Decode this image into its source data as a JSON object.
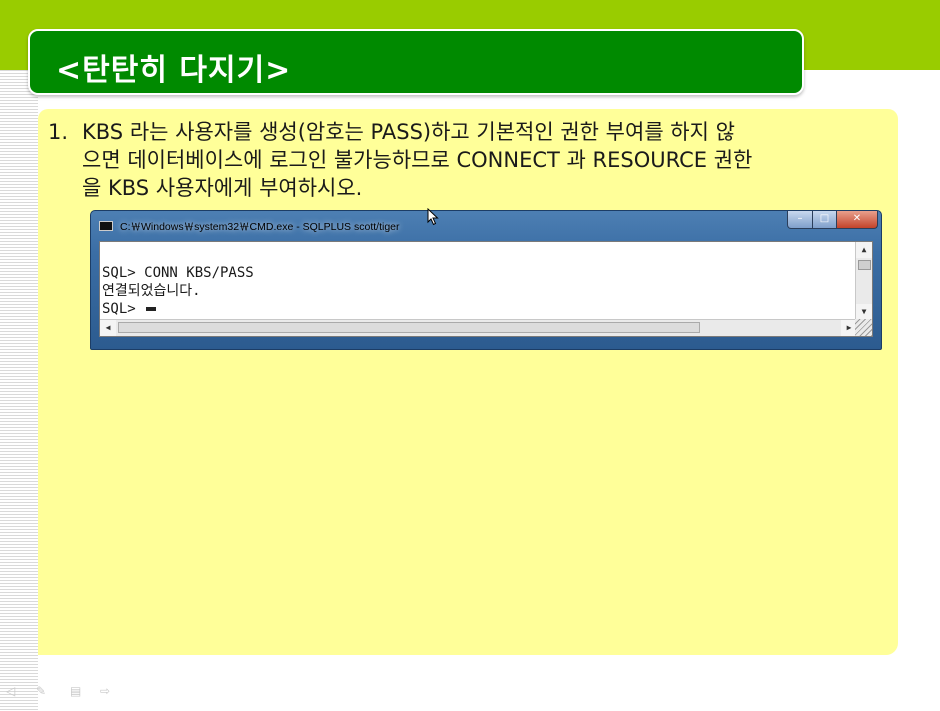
{
  "title": "<탄탄히 다지기>",
  "question": {
    "number": "1.",
    "lines": [
      "KBS 라는 사용자를 생성(암호는 PASS)하고 기본적인 권한 부여를 하지 않",
      "으면 데이터베이스에 로그인 불가능하므로 CONNECT 과 RESOURCE 권한",
      "을 KBS 사용자에게 부여하시오."
    ]
  },
  "cmd": {
    "title": "C:￦Windows￦system32￦CMD.exe - SQLPLUS  scott/tiger",
    "buttons": {
      "minimize": "–",
      "maximize": "□",
      "close": "✕"
    },
    "lines": [
      "SQL> CONN KBS/PASS",
      "연결되었습니다.",
      "SQL> "
    ]
  },
  "icons": {
    "cmd_app": "console-icon",
    "pointer": "mouse-pointer-icon",
    "nav_prev": "nav-prev-icon",
    "nav_pen": "pen-icon",
    "nav_menu": "menu-icon",
    "nav_next": "nav-next-icon"
  },
  "colors": {
    "band": "#99cc00",
    "title_bg": "#008a00",
    "content_bg": "#ffff99",
    "window_frame": "#3b6ea5"
  }
}
